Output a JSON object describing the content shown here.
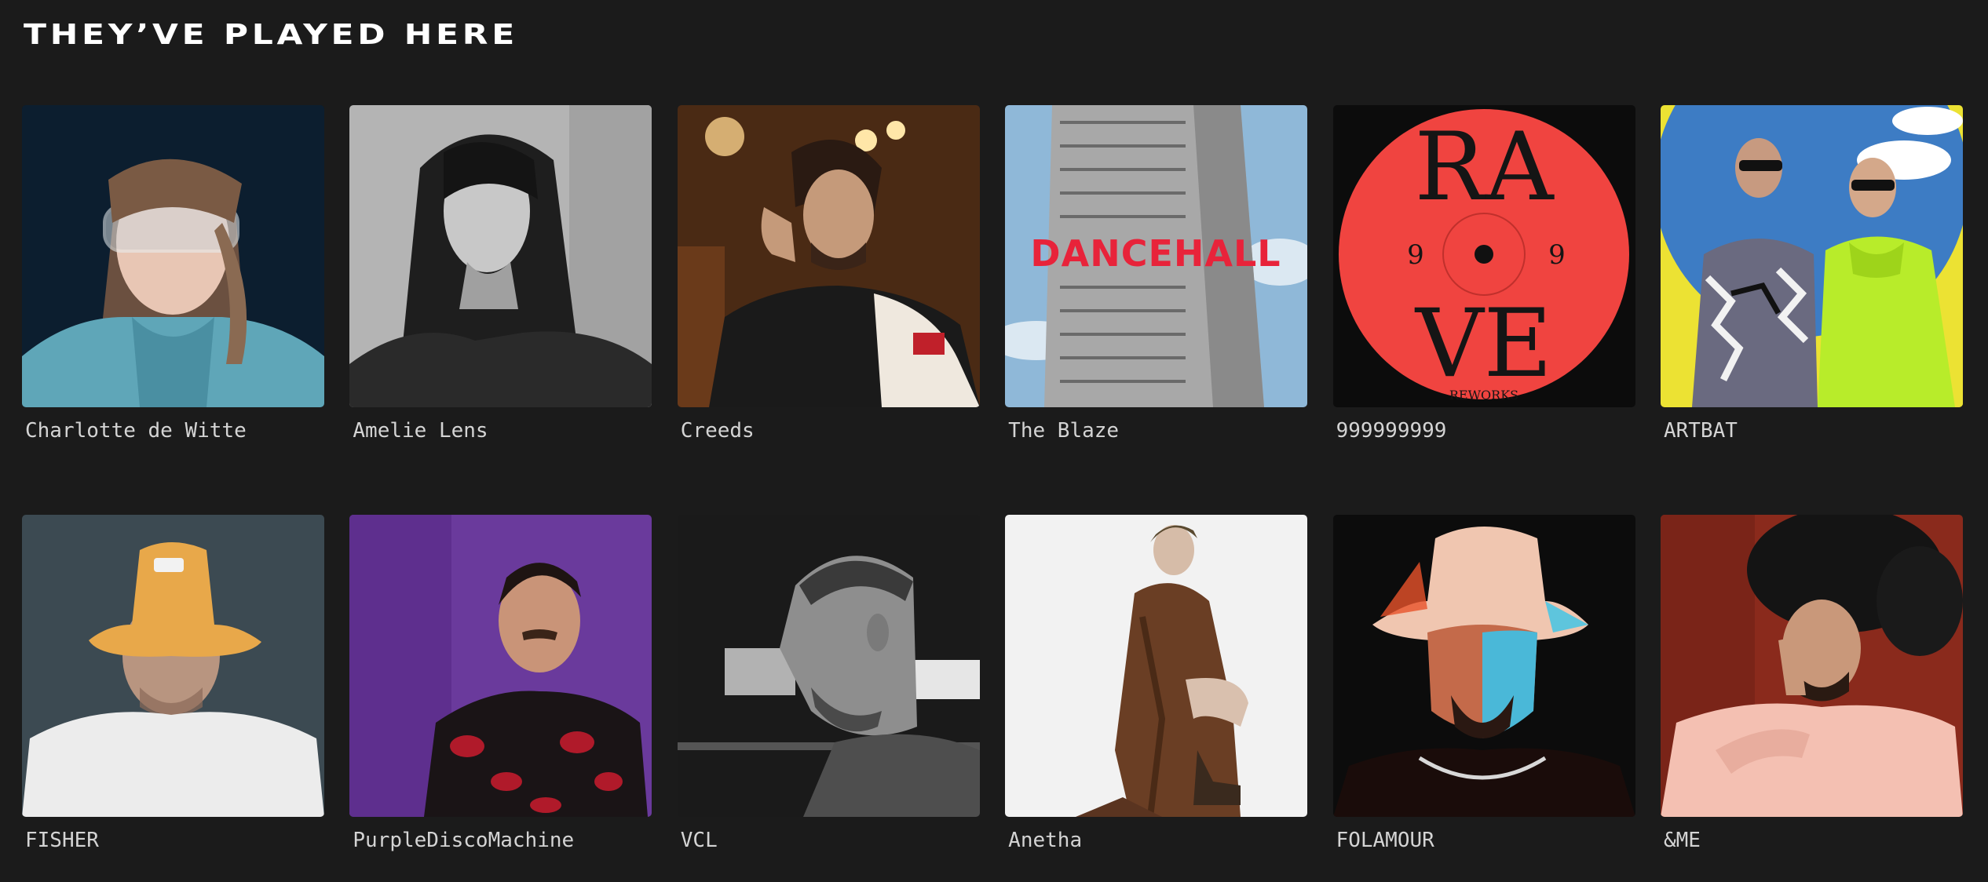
{
  "section": {
    "title": "THEY’VE PLAYED HERE"
  },
  "artists": [
    {
      "name": "Charlotte de Witte",
      "photo": "portrait-woman-goggles"
    },
    {
      "name": "Amelie Lens",
      "photo": "portrait-woman-bw"
    },
    {
      "name": "Creeds",
      "photo": "portrait-man-warm-bar"
    },
    {
      "name": "The Blaze",
      "photo": "album-dancehall-tower",
      "cover_text": "DANCEHALL"
    },
    {
      "name": "999999999",
      "photo": "album-rave-vinyl",
      "cover_text": {
        "top": "RA",
        "bottom": "VE",
        "side_left": "9",
        "side_right": "9",
        "label": "REWORKS"
      }
    },
    {
      "name": "ARTBAT",
      "photo": "duo-colorful-jackets"
    },
    {
      "name": "FISHER",
      "photo": "portrait-man-bucket-hat"
    },
    {
      "name": "PurpleDiscoMachine",
      "photo": "portrait-man-purple-bg"
    },
    {
      "name": "VCL",
      "photo": "portrait-man-bw-profile"
    },
    {
      "name": "Anetha",
      "photo": "portrait-woman-crouching"
    },
    {
      "name": "FOLAMOUR",
      "photo": "portrait-man-neon-hat"
    },
    {
      "name": "&ME",
      "photo": "portrait-man-curly-hair"
    }
  ],
  "colors": {
    "background": "#1b1b1b",
    "title": "#ffffff",
    "label": "#d4d4d4",
    "dancehall": "#e8233a",
    "rave_red": "#f04440"
  }
}
